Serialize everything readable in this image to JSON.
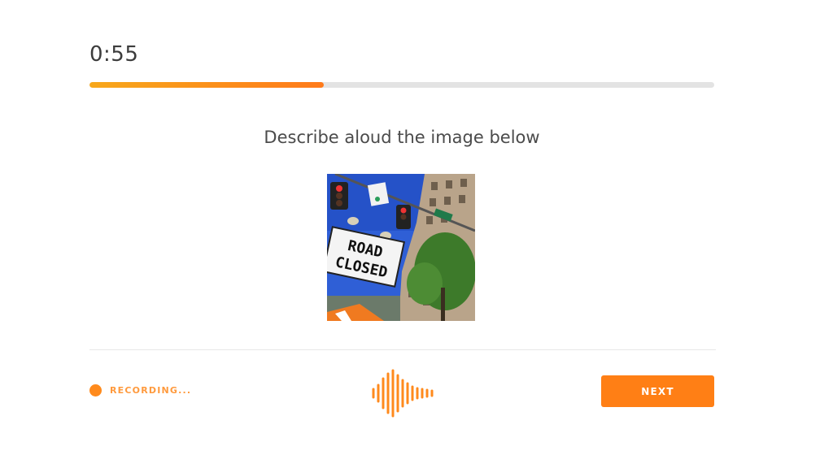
{
  "timer": {
    "text": "0:55"
  },
  "progress": {
    "fraction": 0.375
  },
  "prompt": {
    "text": "Describe aloud the image below"
  },
  "photo": {
    "sign_line1": "ROAD",
    "sign_line2": "CLOSED"
  },
  "recording": {
    "label": "RECORDING...",
    "icon": "recording-dot-icon"
  },
  "waveform": {
    "icon": "waveform-icon"
  },
  "next_button": {
    "label": "NEXT"
  },
  "colors": {
    "accent": "#ff7f15",
    "progress_start": "#f7a81b",
    "track": "#e3e3e3",
    "text": "#4b4b4b"
  }
}
